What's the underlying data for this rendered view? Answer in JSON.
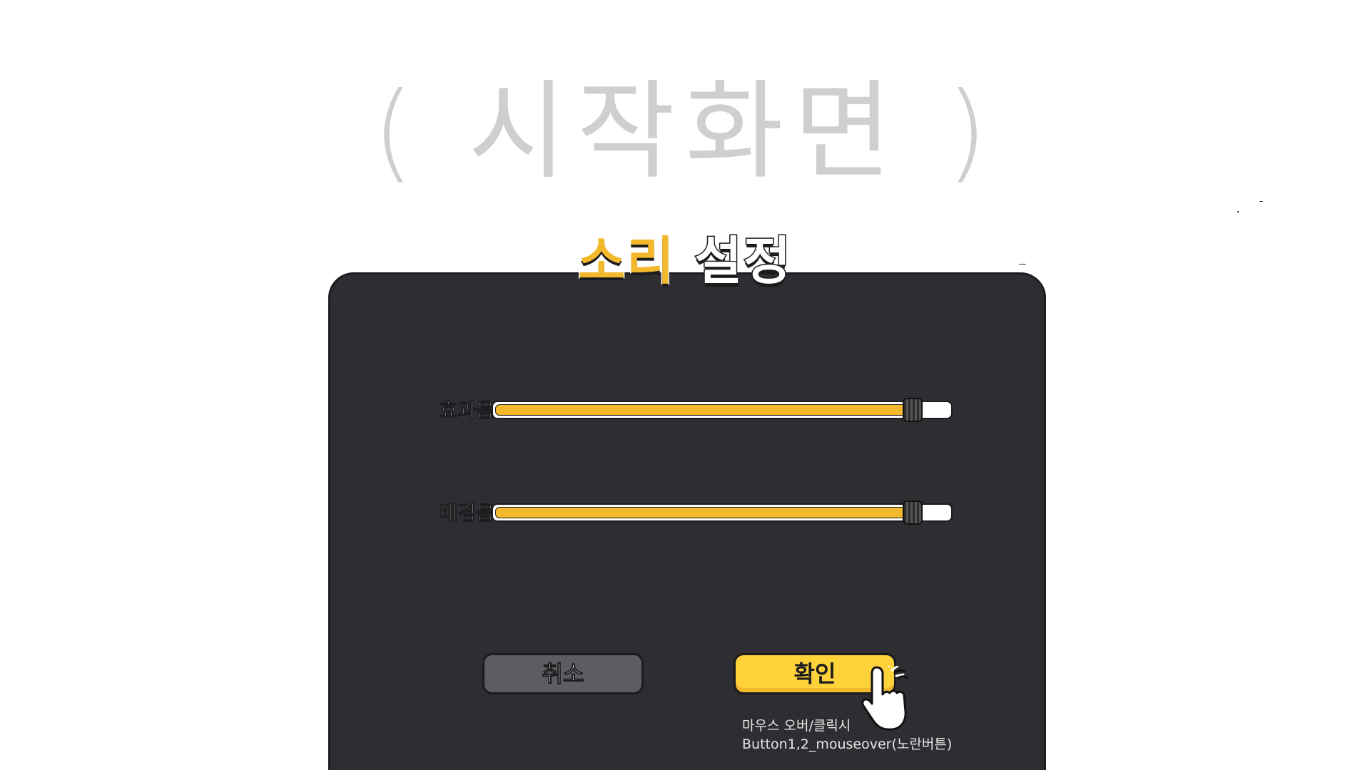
{
  "background_caption": "( 시작화면 )",
  "dialog": {
    "title_part1": "소리",
    "title_part2": "설정",
    "sliders": [
      {
        "label": "효과음",
        "value_fraction": 0.92
      },
      {
        "label": "배경음",
        "value_fraction": 0.92
      }
    ],
    "cancel_label": "취소",
    "confirm_label": "확인",
    "note_line1": "마우스 오버/클릭시",
    "note_line2": "Button1,2_mouseover(노란버튼)"
  },
  "colors": {
    "panel": "#2e2d31",
    "accent_yellow": "#f4b82d",
    "confirm_yellow": "#ffd23a",
    "cancel_gray": "#5d5d61",
    "caption_gray": "#cfcfcf"
  },
  "icons": {
    "cursor": "hand-pointer-click-icon"
  }
}
